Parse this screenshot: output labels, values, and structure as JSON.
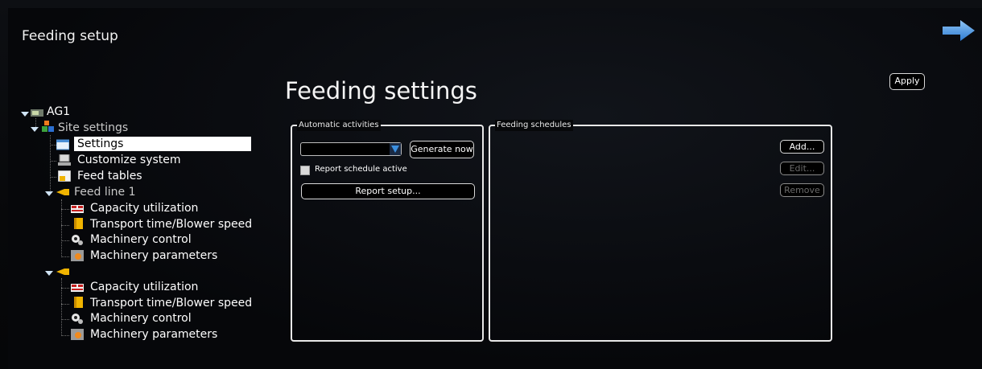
{
  "window": {
    "title": "Feeding setup",
    "apply_label": "Apply"
  },
  "page": {
    "title": "Feeding settings"
  },
  "automatic": {
    "group_label": "Automatic activities",
    "select_value": "",
    "generate_label": "Generate now",
    "report_checkbox_label": "Report schedule active",
    "report_checked": false,
    "report_setup_label": "Report setup..."
  },
  "schedules": {
    "group_label": "Feeding schedules",
    "add_label": "Add...",
    "edit_label": "Edit...",
    "remove_label": "Remove"
  },
  "tree": {
    "root": "AG1",
    "site_settings": "Site settings",
    "settings": "Settings",
    "customize": "Customize system",
    "feed_tables": "Feed tables",
    "feed_line_1": "Feed line 1",
    "line1_items": [
      "Capacity utilization",
      "Transport time/Blower speed",
      "Machinery control",
      "Machinery parameters"
    ],
    "line2_items": [
      "Capacity utilization",
      "Transport time/Blower speed",
      "Machinery control",
      "Machinery parameters"
    ]
  },
  "icons": {
    "nav": "arrow-right-icon",
    "root": "device-icon",
    "site": "site-settings-icon",
    "settings": "settings-window-icon",
    "customize": "computer-icon",
    "feed_tables": "table-icon",
    "feed_line": "feed-pipe-icon",
    "capacity": "capacity-icon",
    "transport": "transport-icon",
    "control": "gears-icon",
    "parameters": "parameters-icon"
  },
  "colors": {
    "accent": "#3b8fe0",
    "background": "#07080a",
    "border": "#e8e8e8"
  }
}
